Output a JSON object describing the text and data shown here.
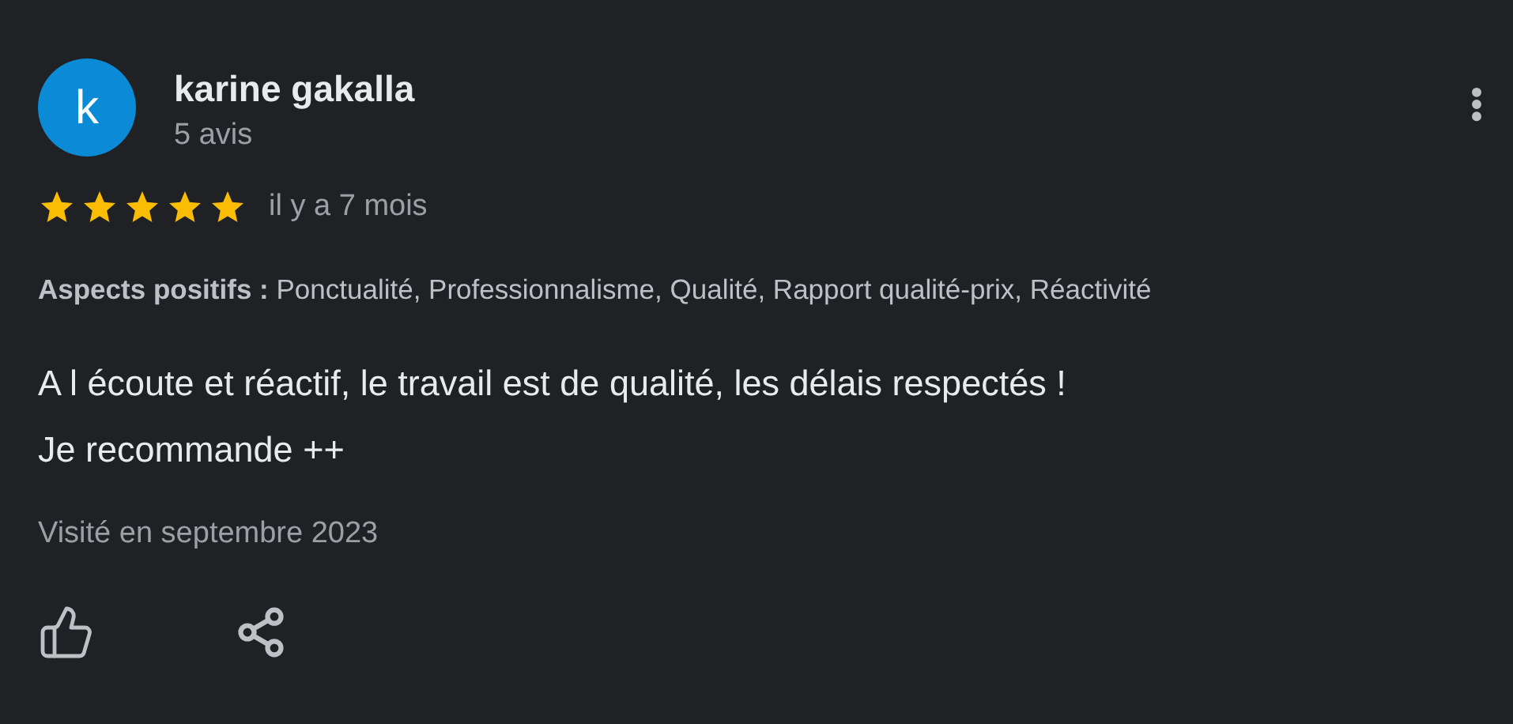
{
  "review": {
    "avatar": {
      "letter": "k",
      "color": "#0b8ad6"
    },
    "name": "karine gakalla",
    "review_count": "5 avis",
    "stars": 5,
    "time": "il y a 7 mois",
    "aspects": "**Aspects positifs :** Ponctualité, Professionnalisme, Qualité, Rapport qualité-prix, Réactivité",
    "body": [
      "A l écoute et réactif, le travail est de qualité, les délais respectés !",
      "Je recommande ++"
    ],
    "visit": "Visité en septembre 2023"
  }
}
